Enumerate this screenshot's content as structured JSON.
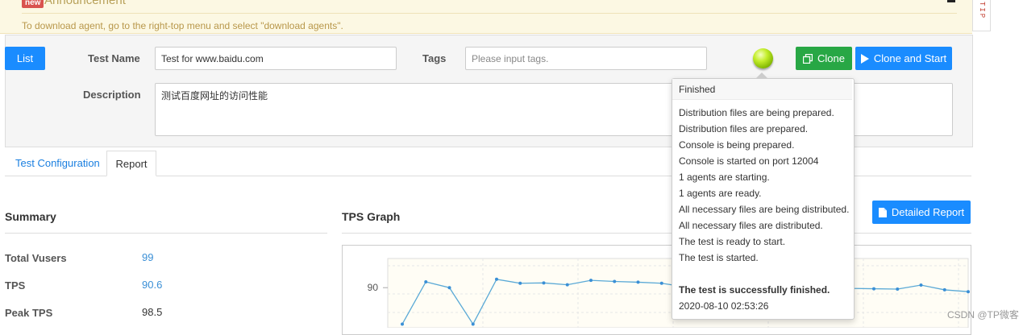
{
  "announcement": {
    "badge": "new",
    "title": "Announcement",
    "text": "To download agent, go to the right-top menu and select \"download agents\".",
    "side_tab": "TIP"
  },
  "header": {
    "list_button": "List",
    "test_name_label": "Test Name",
    "test_name_value": "Test for www.baidu.com",
    "tags_label": "Tags",
    "tags_placeholder": "Please input tags.",
    "description_label": "Description",
    "description_value": "测试百度网址的访问性能",
    "clone_button": "Clone",
    "clone_start_button": "Clone and Start",
    "status_color": "#a6d610"
  },
  "tabs": [
    {
      "label": "Test Configuration",
      "active": false
    },
    {
      "label": "Report",
      "active": true
    }
  ],
  "summary": {
    "title": "Summary",
    "rows": [
      {
        "label": "Total Vusers",
        "value": "99",
        "color": "#3a8fd6"
      },
      {
        "label": "TPS",
        "value": "90.6",
        "color": "#3a8fd6"
      },
      {
        "label": "Peak TPS",
        "value": "98.5",
        "color": "#333333"
      }
    ]
  },
  "tps": {
    "title": "TPS Graph",
    "detailed_button": "Detailed Report",
    "y_tick": "90"
  },
  "chart_data": {
    "type": "line",
    "title": "",
    "xlabel": "",
    "ylabel": "",
    "ylim": [
      79,
      98
    ],
    "y_ticks": [
      90
    ],
    "series": [
      {
        "values": [
          80,
          91.6,
          90,
          80,
          92.3,
          91.2,
          91.3,
          90.8,
          92,
          91.7,
          91.5,
          91.2,
          90.2,
          89.8,
          91.7,
          91.8,
          91.4,
          91.2,
          91.2,
          89.8,
          89.7,
          89.6,
          90.7,
          89.4,
          88.9
        ]
      }
    ]
  },
  "popover": {
    "title": "Finished",
    "lines": [
      "Distribution files are being prepared.",
      "Distribution files are prepared.",
      "Console is being prepared.",
      "Console is started on port 12004",
      "1 agents are starting.",
      "1 agents are ready.",
      "All necessary files are being distributed.",
      "All necessary files are distributed.",
      "The test is ready to start.",
      "The test is started."
    ],
    "final_line": "The test is successfully finished.",
    "timestamp": "2020-08-10 02:53:26"
  },
  "watermark": "CSDN @TP微客"
}
